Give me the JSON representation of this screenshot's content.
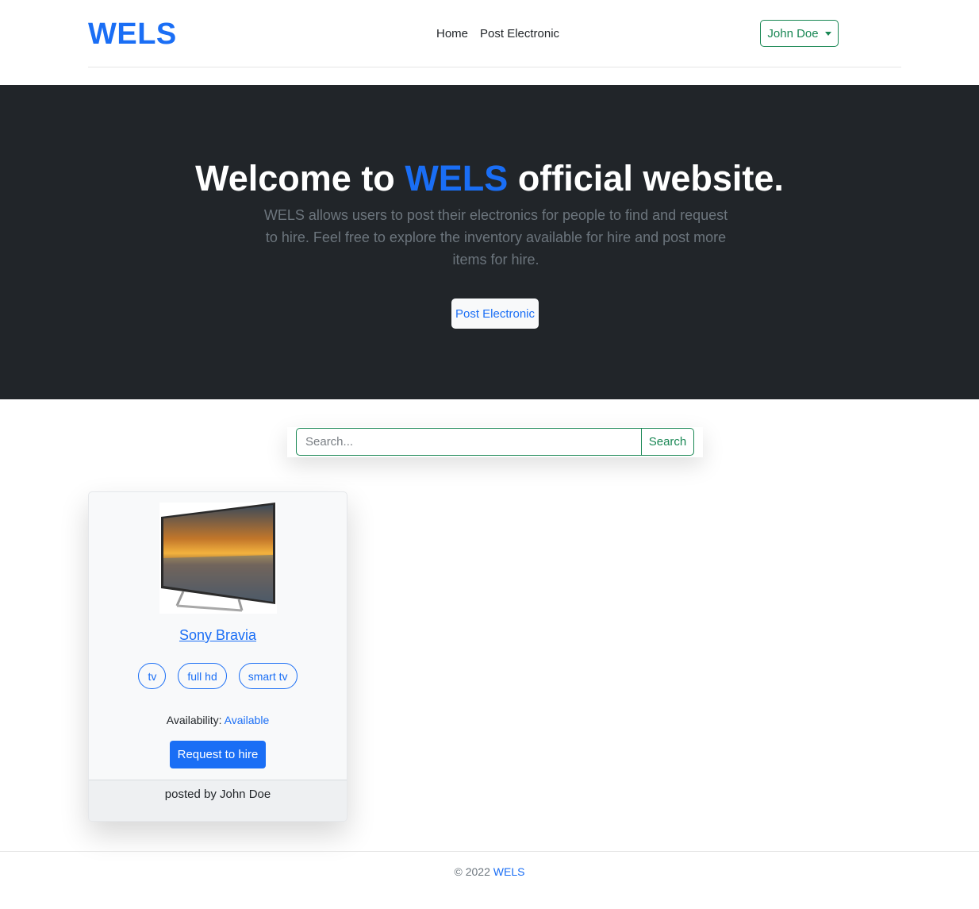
{
  "header": {
    "brand": "WELS",
    "nav": [
      {
        "label": "Home"
      },
      {
        "label": "Post Electronic"
      }
    ],
    "user_menu_label": "John Doe"
  },
  "hero": {
    "title_prefix": "Welcome to ",
    "title_brand": "WELS",
    "title_suffix": " official website.",
    "description": "WELS allows users to post their electronics for people to find and request to hire. Feel free to explore the inventory available for hire and post more items for hire.",
    "cta_label": "Post Electronic"
  },
  "search": {
    "placeholder": "Search...",
    "button_label": "Search"
  },
  "listings": [
    {
      "title": "Sony Bravia",
      "tags": [
        "tv",
        "full hd",
        "smart tv"
      ],
      "availability_label": "Availability:",
      "availability_value": "Available",
      "action_label": "Request to hire",
      "posted_by": "posted by John Doe"
    }
  ],
  "footer": {
    "copyright": "© 2022 ",
    "brand": "WELS"
  },
  "colors": {
    "accent": "#1a6ef5",
    "success": "#198754",
    "hero_bg": "#212529"
  }
}
